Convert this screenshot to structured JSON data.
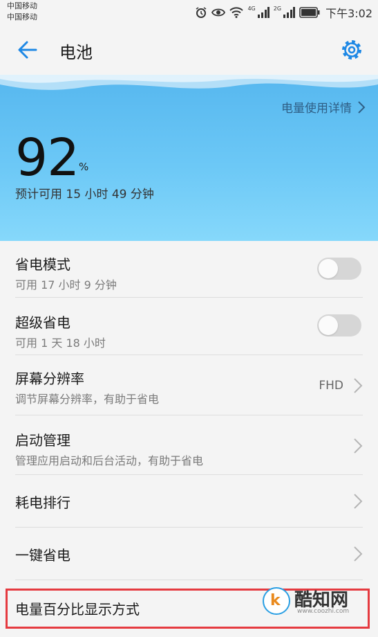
{
  "status_bar": {
    "carrier_1": "中国移动",
    "carrier_2": "中国移动",
    "net_1": "4G",
    "net_2": "2G",
    "time": "下午3:02"
  },
  "app_bar": {
    "title": "电池"
  },
  "hero": {
    "usage_details_link": "电量使用详情",
    "battery_level": "92",
    "percent_unit": "%",
    "estimate": "预计可用 15 小时 49 分钟"
  },
  "settings": [
    {
      "label": "省电模式",
      "sub": "可用 17 小时 9 分钟",
      "control": "toggle",
      "on": false
    },
    {
      "label": "超级省电",
      "sub": "可用 1 天 18 小时",
      "control": "toggle",
      "on": false
    },
    {
      "label": "屏幕分辨率",
      "sub": "调节屏幕分辨率，有助于省电",
      "value": "FHD",
      "control": "chevron"
    },
    {
      "label": "启动管理",
      "sub": "管理应用启动和后台活动，有助于省电",
      "control": "chevron"
    },
    {
      "label": "耗电排行",
      "control": "chevron"
    },
    {
      "label": "一键省电",
      "control": "chevron"
    },
    {
      "label": "电量百分比显示方式",
      "control": "none"
    }
  ],
  "watermark": {
    "logo_letter": "k",
    "name": "酷知网",
    "url": "www.coozhi.com"
  },
  "colors": {
    "accent": "#1e88e5",
    "hero_top": "#56b7ef",
    "hero_bottom": "#86d8fb",
    "highlight": "#e53a40"
  }
}
